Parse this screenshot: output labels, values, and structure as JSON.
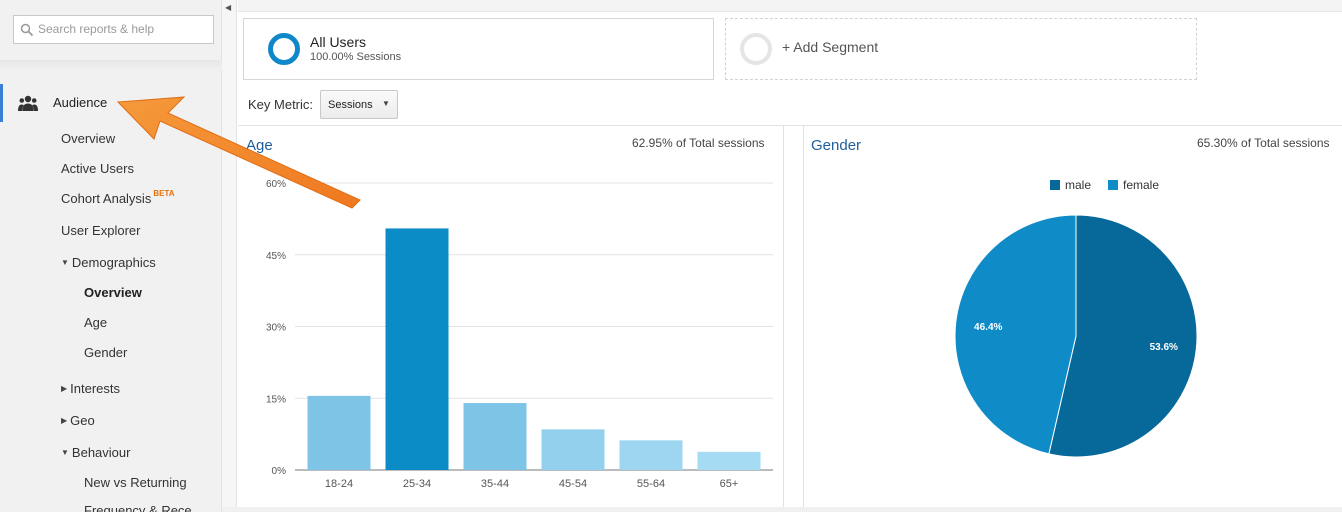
{
  "search": {
    "placeholder": "Search reports & help"
  },
  "sidebar": {
    "section_label": "Audience",
    "items": [
      {
        "label": "Overview"
      },
      {
        "label": "Active Users"
      },
      {
        "label": "Cohort Analysis",
        "badge": "BETA"
      },
      {
        "label": "User Explorer"
      },
      {
        "label": "Demographics",
        "expanded": true
      },
      {
        "label": "Overview",
        "active": true
      },
      {
        "label": "Age"
      },
      {
        "label": "Gender"
      },
      {
        "label": "Interests",
        "expanded": false
      },
      {
        "label": "Geo",
        "expanded": false
      },
      {
        "label": "Behaviour",
        "expanded": true
      },
      {
        "label": "New vs Returning"
      },
      {
        "label": "Frequency & Rece"
      }
    ]
  },
  "segments": {
    "all_users": {
      "name": "All Users",
      "sub": "100.00% Sessions",
      "color": "#0f88c9"
    },
    "add_label": "+ Add Segment"
  },
  "key_metric": {
    "label": "Key Metric:",
    "value": "Sessions"
  },
  "age_panel": {
    "title": "Age",
    "meta": "62.95% of Total sessions"
  },
  "gender_panel": {
    "title": "Gender",
    "meta": "65.30% of Total sessions"
  },
  "chart_data": [
    {
      "type": "bar",
      "title": "Age",
      "categories": [
        "18-24",
        "25-34",
        "35-44",
        "45-54",
        "55-64",
        "65+"
      ],
      "values": [
        15.5,
        50.5,
        14.0,
        8.5,
        6.2,
        3.8
      ],
      "colors": [
        "#7ec4e6",
        "#0b8cc7",
        "#7ec4e6",
        "#93d0ee",
        "#9ed6f1",
        "#a6dbf4"
      ],
      "yticks": [
        "0%",
        "15%",
        "30%",
        "45%",
        "60%"
      ],
      "ylim": [
        0,
        60
      ],
      "grid": true
    },
    {
      "type": "pie",
      "title": "Gender",
      "legend": [
        "male",
        "female"
      ],
      "legend_position": "top",
      "values": [
        53.6,
        46.4
      ],
      "labels": [
        "53.6%",
        "46.4%"
      ],
      "colors": [
        "#06699a",
        "#0f8cc8"
      ]
    }
  ],
  "colors": {
    "accent": "#3a7ed8",
    "arrow": "#f7882f",
    "title": "#1f5d9e"
  }
}
